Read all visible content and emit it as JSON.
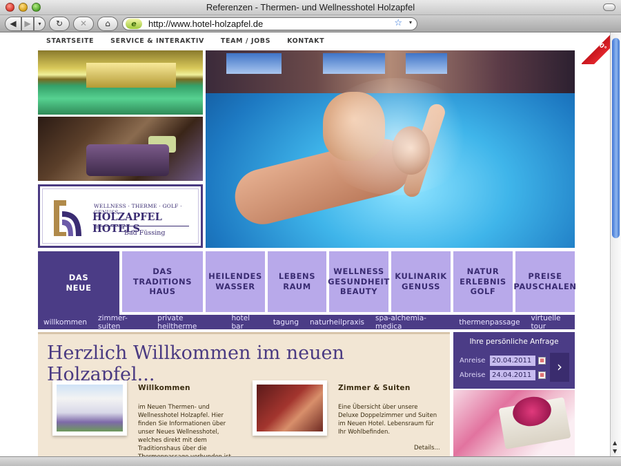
{
  "browser": {
    "window_title": "Referenzen - Thermen- und Wellnesshotel Holzapfel",
    "url": "http://www.hotel-holzapfel.de",
    "url_icon": "e",
    "back_glyph": "◀",
    "forward_glyph": "▶",
    "history_glyph": "▾",
    "reload_glyph": "↻",
    "stop_glyph": "✕",
    "home_glyph": "⌂",
    "bookmark_glyph": "☆",
    "dropdown_glyph": "▾"
  },
  "site": {
    "topnav": [
      "STARTSEITE",
      "SERVICE & INTERAKTIV",
      "TEAM / JOBS",
      "KONTAKT"
    ],
    "badge": "360°",
    "logo": {
      "tagline": "WELLNESS · THERME · GOLF · GENUSS",
      "name": "HOLZAPFEL HOTELS",
      "place": "Bad Füssing"
    },
    "tiles": [
      {
        "label": "DAS\nNEUE",
        "active": true
      },
      {
        "label": "DAS\nTRADITIONS\nHAUS",
        "active": false
      },
      {
        "label": "HEILENDES\nWASSER",
        "active": false
      },
      {
        "label": "LEBENS\nRAUM",
        "active": false
      },
      {
        "label": "WELLNESS\nGESUNDHEIT\nBEAUTY",
        "active": false
      },
      {
        "label": "KULINARIK\nGENUSS",
        "active": false
      },
      {
        "label": "NATUR\nERLEBNIS\nGOLF",
        "active": false
      },
      {
        "label": "PREISE\nPAUSCHALEN",
        "active": false
      }
    ],
    "subnav": [
      "willkommen",
      "zimmer-suiten",
      "private heiltherme",
      "hotel bar",
      "tagung",
      "naturheilpraxis",
      "spa-alchemia-medica",
      "thermenpassage",
      "virtuelle tour"
    ],
    "headline": "Herzlich Willkommen im neuen Holzapfel...",
    "cards": [
      {
        "title": "Willkommen",
        "text": "im Neuen Thermen- und Wellnesshotel Holzapfel. Hier finden Sie Informationen über unser Neues Wellnesshotel, welches direkt mit dem Traditionshaus über die Thermenpassage verbunden ist."
      },
      {
        "title": "Zimmer & Suiten",
        "text": "Eine Übersicht über unsere Deluxe Doppelzimmer und Suiten im Neuen Hotel. Lebensraum für Ihr Wohlbefinden.",
        "link": "Details..."
      }
    ],
    "inquiry": {
      "title": "Ihre persönliche Anfrage",
      "arrival_label": "Anreise",
      "arrival_value": "20.04.2011",
      "departure_label": "Abreise",
      "departure_value": "24.04.2011",
      "submit_glyph": "›"
    }
  },
  "colors": {
    "brand_purple": "#4b3c86",
    "tile_lavender": "#b8a9ea",
    "content_beige": "#f2e6d4",
    "badge_red": "#e2252c"
  }
}
